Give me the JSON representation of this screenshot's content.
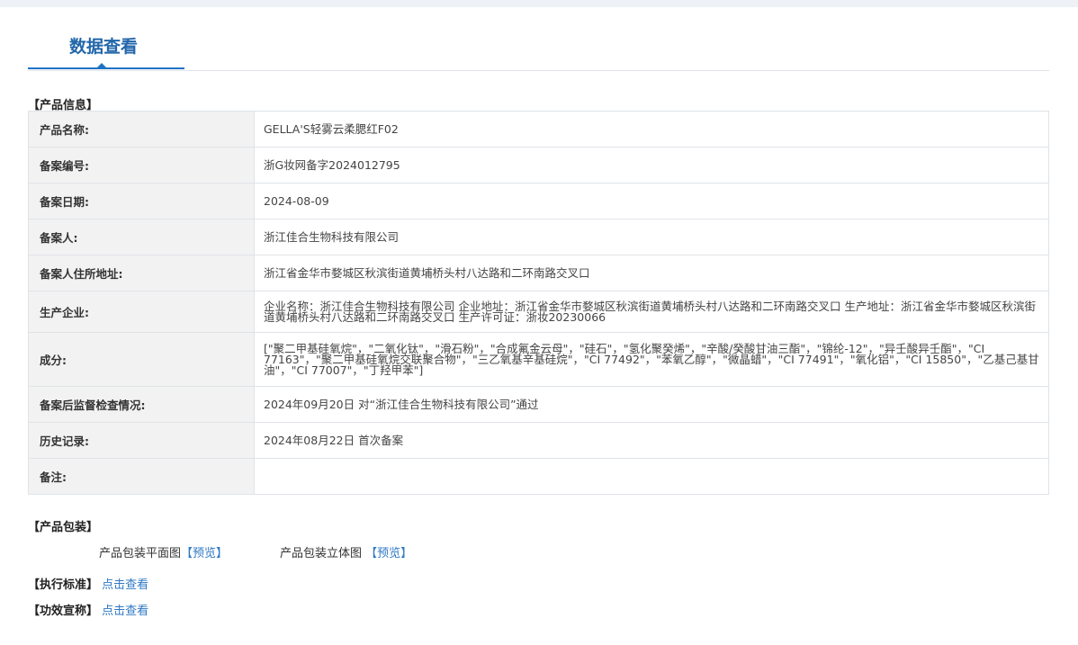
{
  "page": {
    "tab_title": "数据查看"
  },
  "product_info": {
    "section_title": "【产品信息】",
    "rows": [
      {
        "label": "产品名称:",
        "value": "GELLA'S轻雾云柔腮红F02"
      },
      {
        "label": "备案编号:",
        "value": "浙G妆网备字2024012795"
      },
      {
        "label": "备案日期:",
        "value": "2024-08-09"
      },
      {
        "label": "备案人:",
        "value": "浙江佳合生物科技有限公司"
      },
      {
        "label": "备案人住所地址:",
        "value": "浙江省金华市婺城区秋滨街道黄埔桥头村八达路和二环南路交叉口"
      },
      {
        "label": "生产企业:",
        "value": "企业名称：浙江佳合生物科技有限公司 企业地址：浙江省金华市婺城区秋滨街道黄埔桥头村八达路和二环南路交叉口 生产地址：浙江省金华市婺城区秋滨街道黄埔桥头村八达路和二环南路交叉口 生产许可证：浙妆20230066"
      },
      {
        "label": "成分:",
        "value": "[\"聚二甲基硅氧烷\"，\"二氧化钛\"，\"滑石粉\"，\"合成氟金云母\"，\"硅石\"，\"氢化聚癸烯\"，\"辛酸/癸酸甘油三酯\"，\"锦纶-12\"，\"异壬酸异壬酯\"，\"CI 77163\"，\"聚二甲基硅氧烷交联聚合物\"，\"三乙氧基辛基硅烷\"，\"CI 77492\"，\"苯氧乙醇\"，\"微晶蜡\"，\"CI 77491\"，\"氧化铝\"，\"CI 15850\"，\"乙基己基甘油\"，\"CI 77007\"，\"丁羟甲苯\"]"
      },
      {
        "label": "备案后监督检查情况:",
        "value": "2024年09月20日 对“浙江佳合生物科技有限公司”通过"
      },
      {
        "label": "历史记录:",
        "value": "2024年08月22日 首次备案"
      },
      {
        "label": "备注:",
        "value": ""
      }
    ]
  },
  "packaging": {
    "section_title": "【产品包装】",
    "flat_label": "产品包装平面图",
    "flat_link": "【预览】",
    "stereo_label": "产品包装立体图",
    "stereo_link": "【预览】"
  },
  "standard": {
    "label": "【执行标准】",
    "link": "点击查看"
  },
  "efficacy": {
    "label": "【功效宣称】",
    "link": "点击查看"
  }
}
